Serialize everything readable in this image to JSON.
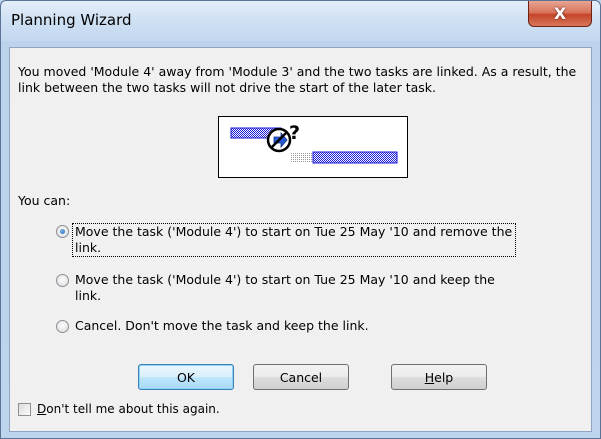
{
  "window": {
    "title": "Planning Wizard",
    "close_symbol": "X"
  },
  "message": "You moved 'Module 4' away from 'Module 3' and the two tasks are linked.  As a result, the link between the two tasks will not drive the start of the later task.",
  "diagram": {
    "question_mark": "?"
  },
  "you_can_label": "You can:",
  "options": [
    {
      "label": "Move the task ('Module 4') to start on Tue 25 May '10 and remove the link.",
      "selected": true
    },
    {
      "label": "Move the task ('Module 4') to start on Tue 25 May '10 and keep the link.",
      "selected": false
    },
    {
      "label": "Cancel.  Don't move the task and keep the link.",
      "selected": false
    }
  ],
  "buttons": {
    "ok": "OK",
    "cancel": "Cancel",
    "help_mnemonic": "H",
    "help_rest": "elp"
  },
  "dont_tell": {
    "mnemonic": "D",
    "rest": "on't tell me about this again.",
    "checked": false
  },
  "colors": {
    "accent": "#3c7fb1",
    "bar_blue": "#1a1ad6",
    "window_frame": "#bcd3ea"
  }
}
